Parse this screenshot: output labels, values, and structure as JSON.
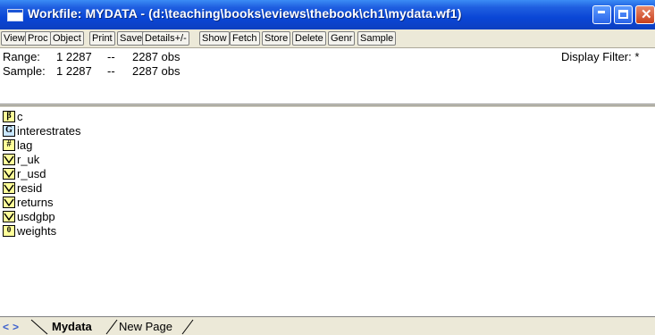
{
  "window": {
    "title": "Workfile: MYDATA - (d:\\teaching\\books\\eviews\\thebook\\ch1\\mydata.wf1)",
    "accent": "#0a46d6",
    "close_color": "#c8401c"
  },
  "toolbar": {
    "buttons": [
      {
        "label": "View"
      },
      {
        "label": "Proc"
      },
      {
        "label": "Object"
      },
      {
        "label": "Print"
      },
      {
        "label": "Save"
      },
      {
        "label": "Details+/-"
      },
      {
        "label": "Show"
      },
      {
        "label": "Fetch"
      },
      {
        "label": "Store"
      },
      {
        "label": "Delete"
      },
      {
        "label": "Genr"
      },
      {
        "label": "Sample"
      }
    ]
  },
  "info": {
    "range_label": "Range:",
    "range_value": "1 2287",
    "range_sep": "--",
    "range_obs": "2287 obs",
    "sample_label": "Sample:",
    "sample_value": "1 2287",
    "sample_sep": "--",
    "sample_obs": "2287 obs",
    "display_filter": "Display Filter: *"
  },
  "objects": [
    {
      "name": "c",
      "icon": "coefficient-icon",
      "glyph": "β"
    },
    {
      "name": "interestrates",
      "icon": "group-icon",
      "glyph": "G"
    },
    {
      "name": "lag",
      "icon": "scalar-icon",
      "glyph": "#"
    },
    {
      "name": "r_uk",
      "icon": "series-icon",
      "glyph": ""
    },
    {
      "name": "r_usd",
      "icon": "series-icon",
      "glyph": ""
    },
    {
      "name": "resid",
      "icon": "series-icon",
      "glyph": ""
    },
    {
      "name": "returns",
      "icon": "series-icon",
      "glyph": ""
    },
    {
      "name": "usdgbp",
      "icon": "series-icon",
      "glyph": ""
    },
    {
      "name": "weights",
      "icon": "vector-icon",
      "glyph": "0"
    }
  ],
  "tabs": [
    {
      "label": "Mydata",
      "active": true
    },
    {
      "label": "New Page",
      "active": false
    }
  ]
}
